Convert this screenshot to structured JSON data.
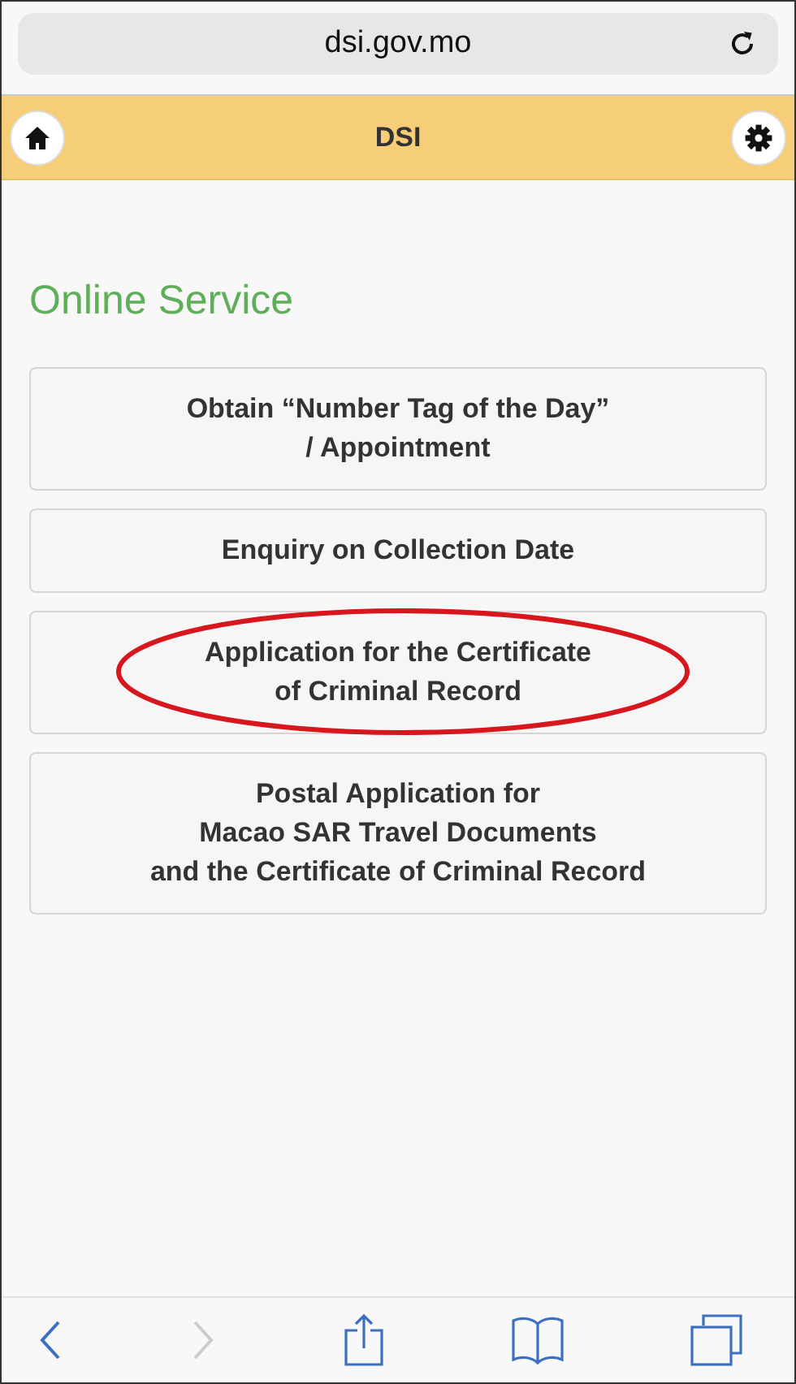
{
  "browser": {
    "address": "dsi.gov.mo"
  },
  "header": {
    "title": "DSI"
  },
  "section_title": "Online Service",
  "services": [
    {
      "label": "Obtain “Number Tag of the Day”\n/ Appointment",
      "circled": false
    },
    {
      "label": "Enquiry on Collection Date",
      "circled": false
    },
    {
      "label": "Application for the Certificate\nof Criminal Record",
      "circled": true
    },
    {
      "label": "Postal Application for\nMacao SAR Travel Documents\nand the Certificate of Criminal Record",
      "circled": false
    }
  ],
  "toolbar": {
    "back_disabled": false,
    "forward_disabled": true
  }
}
